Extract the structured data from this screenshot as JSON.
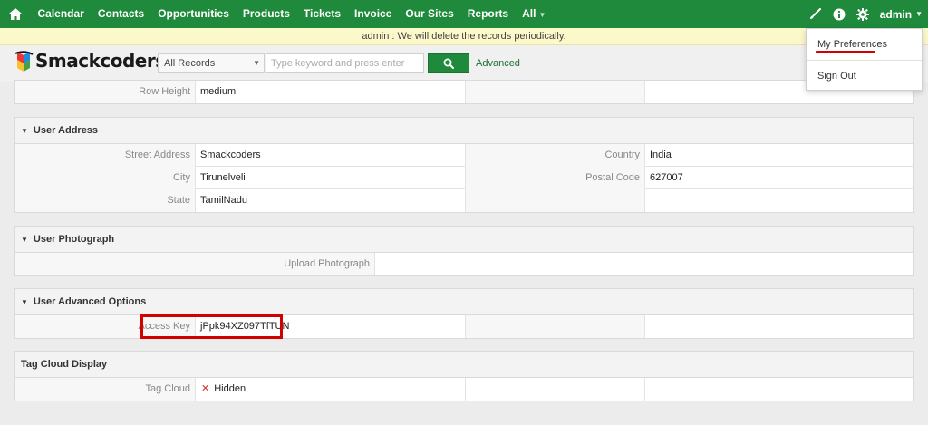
{
  "nav": {
    "items": [
      "Calendar",
      "Contacts",
      "Opportunities",
      "Products",
      "Tickets",
      "Invoice",
      "Our Sites",
      "Reports",
      "All"
    ],
    "user": "admin"
  },
  "notice": "admin : We will delete the records periodically.",
  "search": {
    "brand": "Smackcoders",
    "filter_value": "All Records",
    "placeholder": "Type keyword and press enter",
    "advanced_label": "Advanced"
  },
  "user_menu": {
    "items": [
      "My Preferences",
      "Sign Out"
    ]
  },
  "blocks": {
    "top": {
      "row_height_label": "Row Height",
      "row_height_value": "medium"
    },
    "address": {
      "title": "User Address",
      "street_label": "Street Address",
      "street_value": "Smackcoders",
      "country_label": "Country",
      "country_value": "India",
      "city_label": "City",
      "city_value": "Tirunelveli",
      "postal_label": "Postal Code",
      "postal_value": "627007",
      "state_label": "State",
      "state_value": "TamilNadu"
    },
    "photo": {
      "title": "User Photograph",
      "upload_label": "Upload Photograph"
    },
    "advanced": {
      "title": "User Advanced Options",
      "access_key_label": "Access Key",
      "access_key_value": "jPpk94XZ097TfTUN"
    },
    "tagcloud": {
      "title": "Tag Cloud Display",
      "tag_cloud_label": "Tag Cloud",
      "tag_cloud_value": "Hidden"
    }
  },
  "colors": {
    "nav_green": "#1f8a3b",
    "notice_yellow": "#fbf8c9",
    "highlight_red": "#d40000"
  }
}
